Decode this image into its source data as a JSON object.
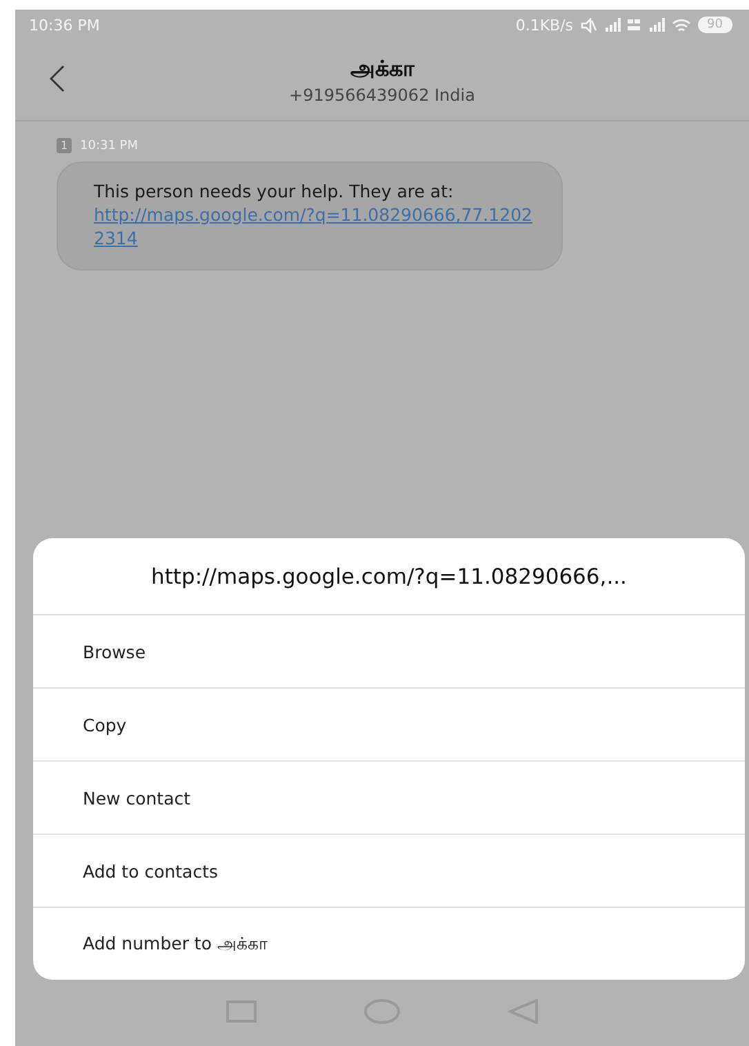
{
  "status_bar": {
    "time": "10:36 PM",
    "speed": "0.1KB/s",
    "battery": "90"
  },
  "header": {
    "title": "அக்கா",
    "subtitle": "+919566439062 India"
  },
  "messages": [
    {
      "sim": "1",
      "time": "10:31 PM",
      "text": "This person needs your help. They are at:",
      "link": "http://maps.google.com/?q=11.08290666,77.12022314"
    }
  ],
  "sheet": {
    "title": "http://maps.google.com/?q=11.08290666,...",
    "items": [
      "Browse",
      "Copy",
      "New contact",
      "Add to contacts",
      "Add number to அக்கா"
    ]
  }
}
